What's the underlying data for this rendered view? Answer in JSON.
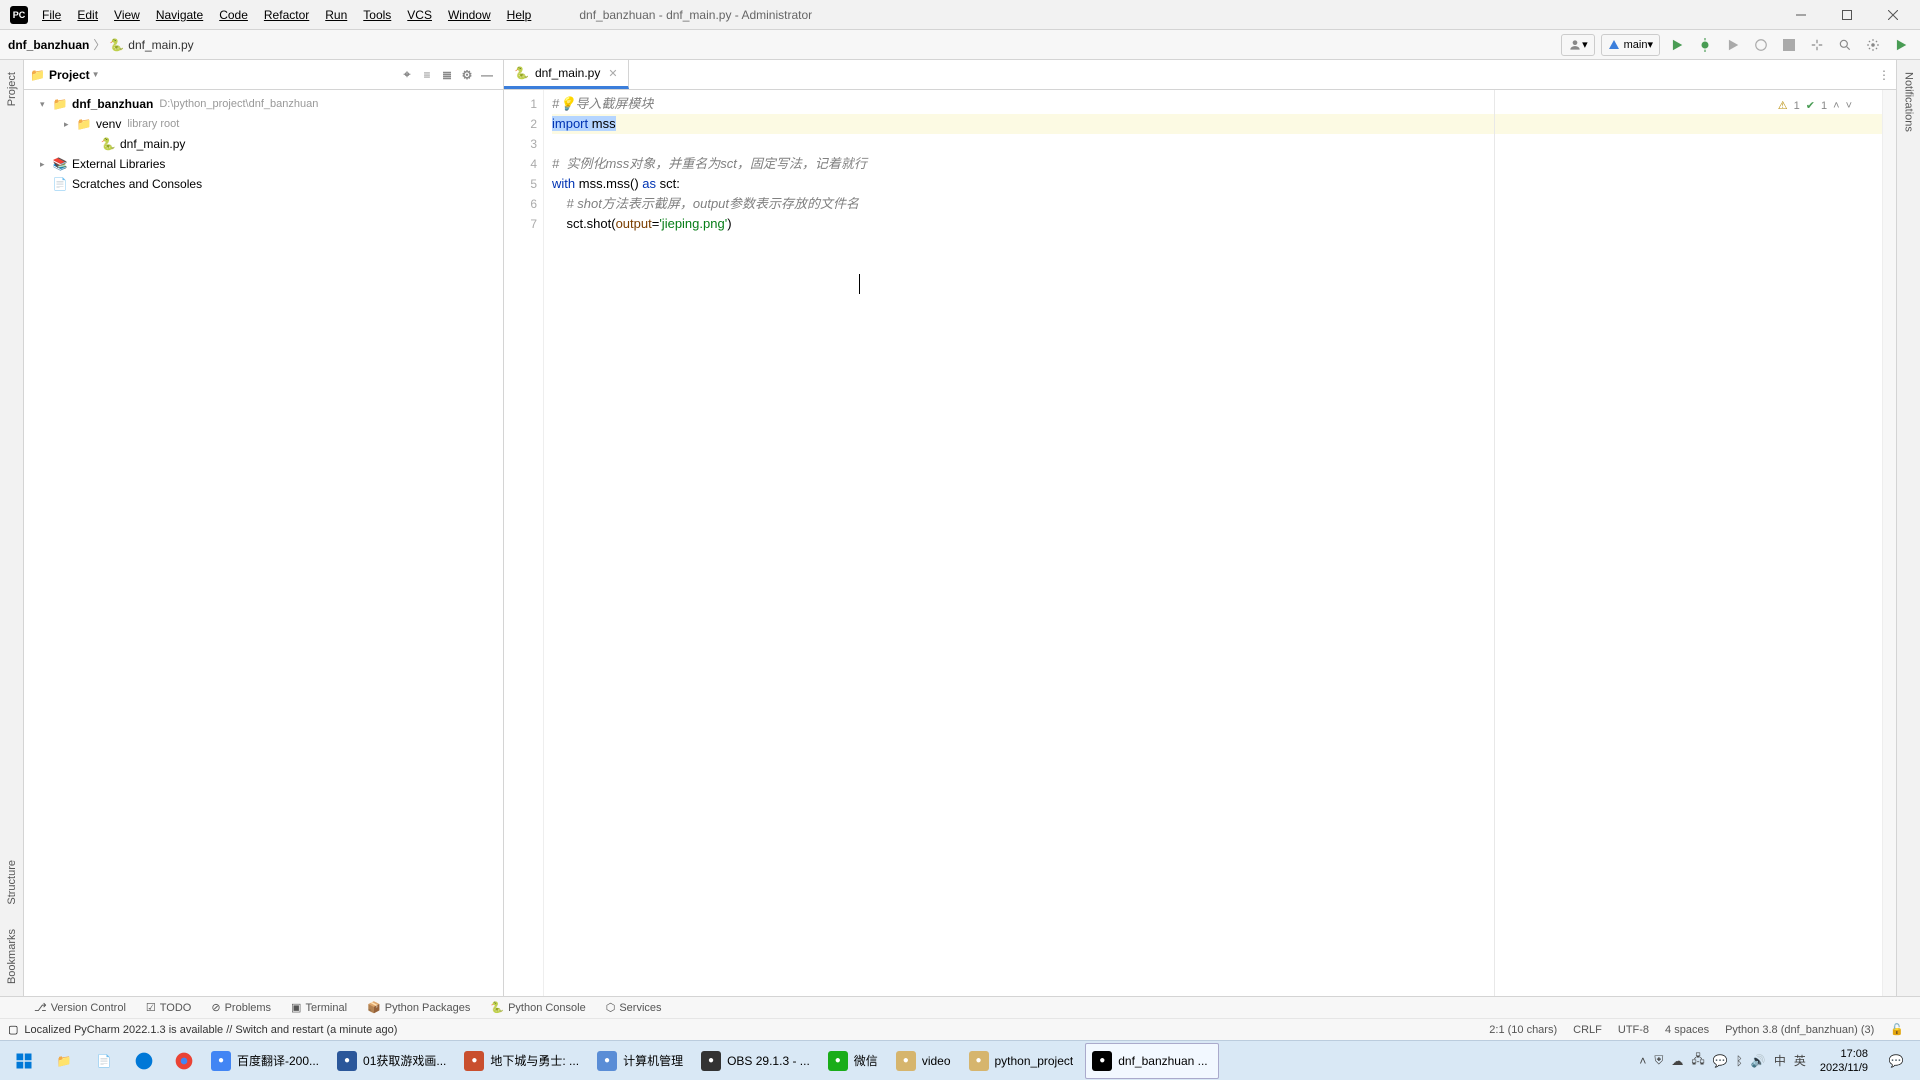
{
  "title": "dnf_banzhuan - dnf_main.py - Administrator",
  "menu": [
    "File",
    "Edit",
    "View",
    "Navigate",
    "Code",
    "Refactor",
    "Run",
    "Tools",
    "VCS",
    "Window",
    "Help"
  ],
  "breadcrumb": {
    "project": "dnf_banzhuan",
    "file": "dnf_main.py"
  },
  "runConfig": "main",
  "sidebar": {
    "title": "Project",
    "root": {
      "name": "dnf_banzhuan",
      "path": "D:\\python_project\\dnf_banzhuan"
    },
    "venv": {
      "name": "venv",
      "hint": "library root"
    },
    "file": "dnf_main.py",
    "extlib": "External Libraries",
    "scratch": "Scratches and Consoles"
  },
  "tabs": [
    {
      "label": "dnf_main.py"
    }
  ],
  "inspections": {
    "warn": "1",
    "ok": "1"
  },
  "code": {
    "l1a": "#",
    "l1b": "导入截屏模块",
    "l2a": "import",
    "l2b": " mss",
    "l4": "#  实例化mss对象，并重名为sct，固定写法，记着就行",
    "l5a": "with",
    "l5b": " mss.mss() ",
    "l5c": "as",
    "l5d": " sct:",
    "l6": "# shot方法表示截屏，output参数表示存放的文件名",
    "l7a": "sct.shot(",
    "l7b": "output",
    "l7c": "=",
    "l7d": "'jieping.png'",
    "l7e": ")"
  },
  "bottomTabs": [
    "Version Control",
    "TODO",
    "Problems",
    "Terminal",
    "Python Packages",
    "Python Console",
    "Services"
  ],
  "statusMsg": "Localized PyCharm 2022.1.3 is available // Switch and restart (a minute ago)",
  "statusRight": {
    "pos": "2:1 (10 chars)",
    "eol": "CRLF",
    "enc": "UTF-8",
    "indent": "4 spaces",
    "interp": "Python 3.8 (dnf_banzhuan) (3)"
  },
  "taskbarApps": [
    {
      "label": "百度翻译-200...",
      "color": "#4285f4"
    },
    {
      "label": "01获取游戏画...",
      "color": "#2b579a"
    },
    {
      "label": "地下城与勇士: ...",
      "color": "#c94f2e"
    },
    {
      "label": "计算机管理",
      "color": "#5a8dd6"
    },
    {
      "label": "OBS 29.1.3 - ...",
      "color": "#333"
    },
    {
      "label": "微信",
      "color": "#1aad19"
    },
    {
      "label": "video",
      "color": "#d6b56d"
    },
    {
      "label": "python_project",
      "color": "#d6b56d"
    },
    {
      "label": "dnf_banzhuan ...",
      "color": "#000"
    }
  ],
  "tray": {
    "ime1": "中",
    "ime2": "英",
    "time": "17:08",
    "date": "2023/11/9"
  }
}
